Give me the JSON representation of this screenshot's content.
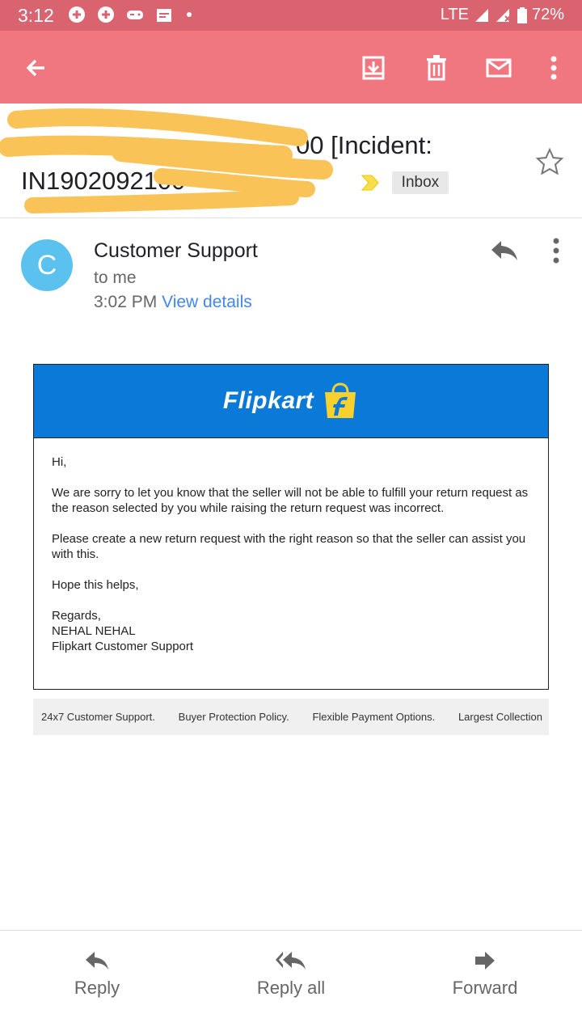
{
  "status_bar": {
    "time": "3:12",
    "network": "LTE",
    "battery": "72%"
  },
  "app_bar": {
    "icons": [
      "back-arrow-icon",
      "archive-icon",
      "delete-icon",
      "mark-unread-icon",
      "more-vert-icon"
    ]
  },
  "subject": {
    "line1_visible": "00 [Incident:",
    "line2_visible": "IN1902092100",
    "label": "Inbox"
  },
  "sender": {
    "initial": "C",
    "name": "Customer Support",
    "to": "to me",
    "time": "3:02 PM",
    "details_link": "View details"
  },
  "email": {
    "brand": "Flipkart",
    "greeting": "Hi,",
    "paragraph1": "We are sorry to let you know that the seller will not be able to fulfill your return request as the reason selected by you while raising the return request was incorrect.",
    "paragraph2": "Please create a new return request with the right reason so that the seller can assist you with this.",
    "paragraph3": "Hope this helps,",
    "signoff": "Regards,",
    "agent": "NEHAL NEHAL",
    "team": "Flipkart Customer Support"
  },
  "footer_items": [
    "24x7 Customer Support.",
    "Buyer Protection Policy.",
    "Flexible Payment Options.",
    "Largest Collection"
  ],
  "actions": {
    "reply": "Reply",
    "reply_all": "Reply all",
    "forward": "Forward"
  },
  "colors": {
    "status_bar": "#d9646f",
    "app_bar": "#f07680",
    "avatar": "#5bc2f0",
    "flipkart_blue": "#0a79d8",
    "flipkart_yellow": "#f8d12f",
    "link": "#4285f4",
    "redaction": "#f9c358"
  }
}
